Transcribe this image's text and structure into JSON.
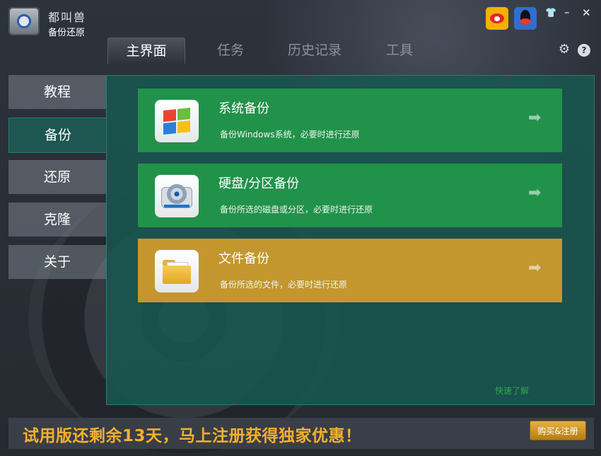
{
  "app": {
    "brand": "都叫兽",
    "product": "备份还原"
  },
  "title_bar": {
    "icons": [
      "weibo-icon",
      "qq-icon",
      "skin-icon",
      "minimize-icon",
      "close-icon"
    ],
    "skin_glyph": "👕",
    "minimize_glyph": "–",
    "close_glyph": "✕"
  },
  "tabs": [
    {
      "label": "主界面",
      "active": true
    },
    {
      "label": "任务",
      "active": false
    },
    {
      "label": "历史记录",
      "active": false
    },
    {
      "label": "工具",
      "active": false
    }
  ],
  "toolbar": {
    "settings_glyph": "⚙",
    "help_glyph": "?"
  },
  "sidebar": {
    "items": [
      {
        "label": "教程",
        "selected": false
      },
      {
        "label": "备份",
        "selected": true
      },
      {
        "label": "还原",
        "selected": false
      },
      {
        "label": "克隆",
        "selected": false
      },
      {
        "label": "关于",
        "selected": false
      }
    ]
  },
  "cards": [
    {
      "title": "系统备份",
      "desc": "备份Windows系统，必要时进行还原",
      "icon": "windows-logo-icon",
      "color": "#21924a"
    },
    {
      "title": "硬盘/分区备份",
      "desc": "备份所选的磁盘或分区，必要时进行还原",
      "icon": "hard-disk-icon",
      "color": "#21924a"
    },
    {
      "title": "文件备份",
      "desc": "备份所选的文件，必要时进行还原",
      "icon": "folder-icon",
      "color": "#c4962e"
    }
  ],
  "arrow_glyph": "➡",
  "quick_link": "快速了解",
  "footer": {
    "trial_text": "试用版还剩余13天，马上注册获得独家优惠！",
    "buy_label": "购买&注册"
  },
  "colors": {
    "accent_green": "#21924a",
    "accent_gold": "#c4962e",
    "panel": "#185650",
    "trial_text": "#f4b12a"
  }
}
